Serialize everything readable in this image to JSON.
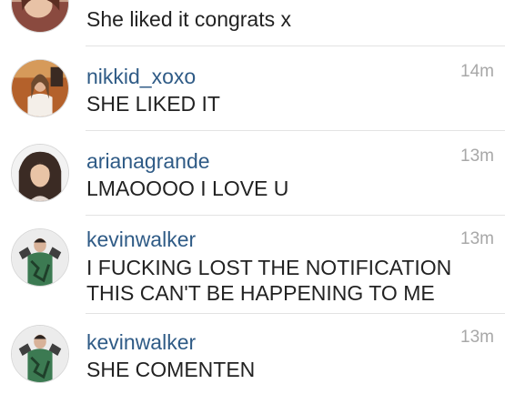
{
  "comments": [
    {
      "username": "",
      "avatar_icon": "profile-photo-icon",
      "text": "She liked it congrats x",
      "time": ""
    },
    {
      "username": "nikkid_xoxo",
      "avatar_icon": "profile-photo-icon",
      "text": "SHE LIKED IT",
      "time": "14m"
    },
    {
      "username": "arianagrande",
      "avatar_icon": "profile-photo-icon",
      "text": "LMAOOOO I LOVE U",
      "time": "13m"
    },
    {
      "username": "kevinwalker",
      "avatar_icon": "profile-photo-icon",
      "text": "I FUCKING LOST THE NOTIFICATION\nTHIS CAN'T BE HAPPENING TO ME",
      "time": "13m"
    },
    {
      "username": "kevinwalker",
      "avatar_icon": "profile-photo-icon",
      "text": "SHE COMENTEN",
      "time": "13m"
    }
  ],
  "colors": {
    "username": "#2f5b86",
    "text": "#222222",
    "time": "#a8a8a8",
    "separator": "#e3e3e3"
  }
}
